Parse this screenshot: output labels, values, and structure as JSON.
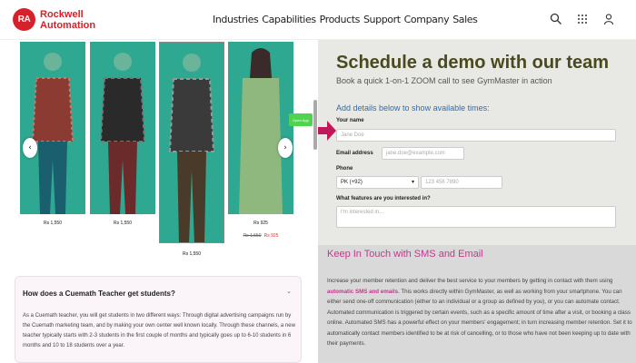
{
  "header": {
    "logo_mark": "RA",
    "logo_line1": "Rockwell",
    "logo_line2": "Automation",
    "nav": [
      "Industries",
      "Capabilities",
      "Products",
      "Support",
      "Company",
      "Sales"
    ],
    "icons": [
      "search-icon",
      "apps-grid-icon",
      "user-icon"
    ]
  },
  "carousel": {
    "prev_label": "‹",
    "next_label": "›",
    "prices": [
      {
        "price": "Rs 1,550"
      },
      {
        "price": "Rs 1,550"
      },
      {
        "price": "Rs 1,550"
      },
      {
        "price": "Rs 925",
        "original": "Rs 1,550",
        "sale": "Rs 925"
      }
    ]
  },
  "open_app": "Open App",
  "faq": {
    "question": "How does a Cuemath Teacher get students?",
    "toggle": "⌄",
    "answer": "As a Cuemath teacher, you will get students in two different ways: Through digital advertising campaigns run by the Cuemath marketing team, and by making your own center well known locally. Through these channels, a new teacher typically starts with 2-3 students in the first couple of months and typically goes up to 6-10 students in 6 months and 10 to 18 students over a year."
  },
  "demo": {
    "title": "Schedule a demo with our team",
    "subtitle": "Book a quick 1-on-1 ZOOM call to see GymMaster in action",
    "form_heading": "Add details below to show available times:",
    "name_label": "Your name",
    "name_placeholder": "Jane Doe",
    "email_label": "Email address",
    "email_placeholder": "jane.doe@example.com",
    "phone_label": "Phone",
    "country_value": "PK (+92)",
    "phone_placeholder": "123 456 7890",
    "features_label": "What features are you interested in?",
    "features_placeholder": "I'm interested in..."
  },
  "sms": {
    "title": "Keep In Touch with SMS and Email",
    "body_before": "Increase your member retention and deliver the best service to your members by getting in contact with them using ",
    "body_bold": "automatic SMS and emails",
    "body_after": ". This works directly within GymMaster, as well as working from your smartphone. You can either send one-off communication (either to an individual or a group as defined by you), or you can automate contact. Automated communication is triggered by certain events, such as a specific amount of time after a visit, or booking a class online. Automated SMS has a powerful effect on your members' engagement; in turn increasing member retention. Set it to automatically contact members identified to be at risk of cancelling, or to those who have not been keeping up to date with their payments."
  },
  "colors": {
    "brand_red": "#d6202a",
    "image_teal": "#2ea891",
    "demo_title": "#4a4a1e",
    "link_blue": "#2d6cb0",
    "accent_pink": "#c0398a",
    "arrow_red": "#c2185b"
  }
}
